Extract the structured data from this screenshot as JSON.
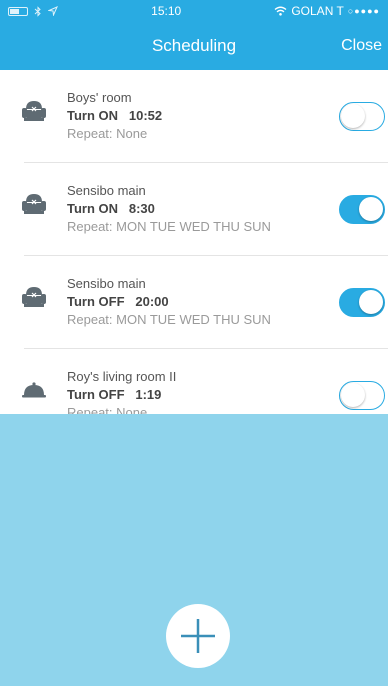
{
  "status_bar": {
    "time": "15:10",
    "carrier": "GOLAN T",
    "signal": "○●●●●"
  },
  "nav": {
    "title": "Scheduling",
    "close_label": "Close"
  },
  "schedules": [
    {
      "name": "Boys' room",
      "action": "Turn ON",
      "time": "10:52",
      "repeat": "Repeat: None",
      "enabled": false,
      "device_icon": "ac-unit-icon"
    },
    {
      "name": "Sensibo main",
      "action": "Turn ON",
      "time": "8:30",
      "repeat": "Repeat: MON TUE WED THU SUN",
      "enabled": true,
      "device_icon": "ac-unit-icon"
    },
    {
      "name": "Sensibo main",
      "action": "Turn OFF",
      "time": "20:00",
      "repeat": "Repeat: MON TUE WED THU SUN",
      "enabled": true,
      "device_icon": "ac-unit-icon"
    },
    {
      "name": "Roy's living room II",
      "action": "Turn OFF",
      "time": "1:19",
      "repeat": "Repeat: None",
      "enabled": false,
      "device_icon": "cloche-icon"
    }
  ],
  "colors": {
    "accent": "#29abe2",
    "bottom_area": "#8fd4ec"
  },
  "add_button_icon": "plus-icon"
}
